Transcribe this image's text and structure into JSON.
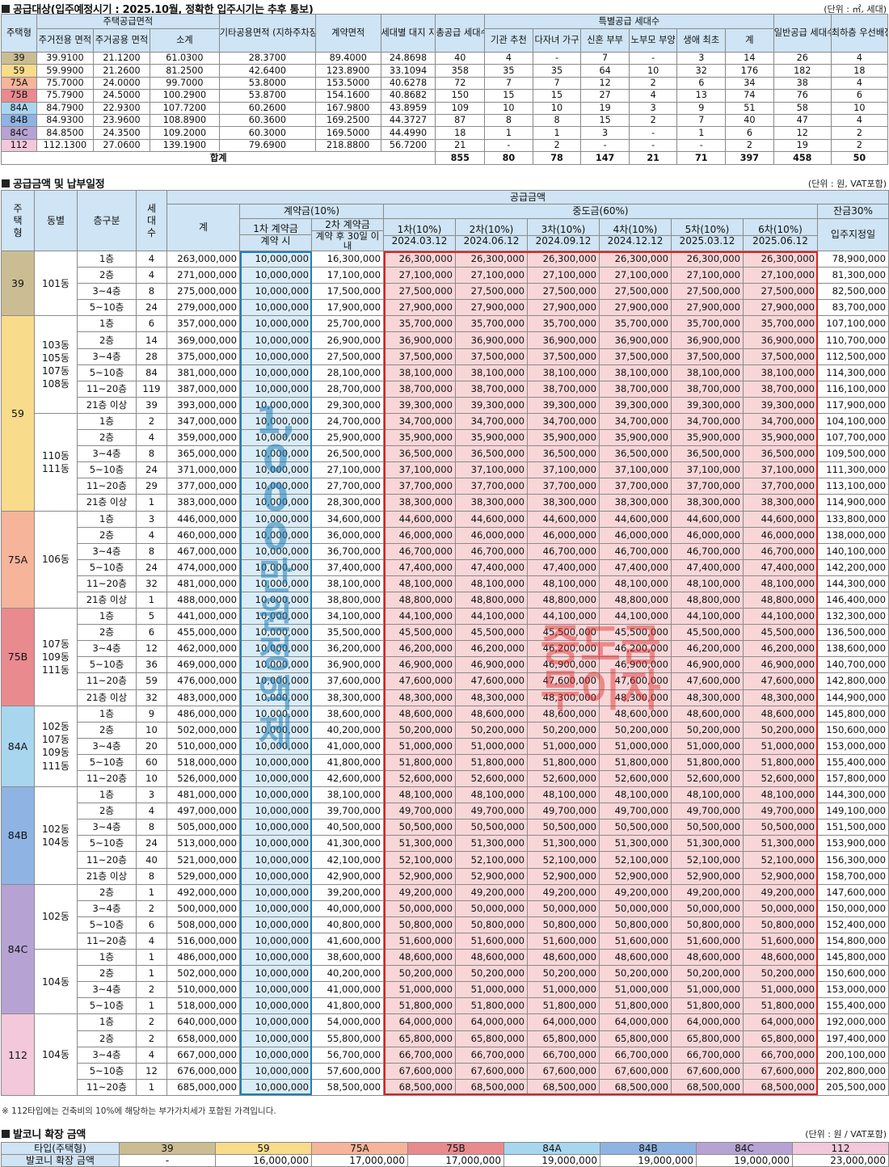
{
  "colors": {
    "t39": "#cbbd93",
    "t59": "#f8dc8c",
    "t75A": "#f6b49a",
    "t75B": "#e98a8f",
    "t84A": "#a9d6ef",
    "t84B": "#8fb3e3",
    "t84C": "#b6a3d4",
    "t112": "#f2c8da",
    "deposit_box": "#1f7fb8",
    "mid_box": "#e02020",
    "header_bg": "#cfe4f4"
  },
  "supply": {
    "title": "공급대상(입주예정시기 : 2025.10월, 정확한 입주시기는 추후 통보)",
    "unit": "(단위 : ㎡, 세대)",
    "headers": {
      "type": "주택형",
      "area_group": "주택공급면적",
      "excl": "주거전용 면적",
      "common": "주거공용 면적",
      "subtotal": "소계",
      "other": "기타공용면적 (지하주차장 등)",
      "contract": "계약면적",
      "land": "세대별 대지 지분",
      "total_units": "총공급 세대수",
      "special_group": "특별공급 세대수",
      "s1": "기관 추천",
      "s2": "다자녀 가구",
      "s3": "신혼 부부",
      "s4": "노부모 부양",
      "s5": "생애 최초",
      "s6": "계",
      "general": "일반공급 세대수",
      "lowest": "최하층 우선배정 세대수"
    },
    "rows": [
      [
        "39",
        "39.9100",
        "21.1200",
        "61.0300",
        "28.3700",
        "89.4000",
        "24.8698",
        "40",
        "4",
        "-",
        "7",
        "-",
        "3",
        "14",
        "26",
        "4"
      ],
      [
        "59",
        "59.9900",
        "21.2600",
        "81.2500",
        "42.6400",
        "123.8900",
        "33.1094",
        "358",
        "35",
        "35",
        "64",
        "10",
        "32",
        "176",
        "182",
        "18"
      ],
      [
        "75A",
        "75.7000",
        "24.0000",
        "99.7000",
        "53.8000",
        "153.5000",
        "40.6278",
        "72",
        "7",
        "7",
        "12",
        "2",
        "6",
        "34",
        "38",
        "4"
      ],
      [
        "75B",
        "75.7900",
        "24.5000",
        "100.2900",
        "53.8700",
        "154.1600",
        "40.8682",
        "150",
        "15",
        "15",
        "27",
        "4",
        "13",
        "74",
        "76",
        "6"
      ],
      [
        "84A",
        "84.7900",
        "22.9300",
        "107.7200",
        "60.2600",
        "167.9800",
        "43.8959",
        "109",
        "10",
        "10",
        "19",
        "3",
        "9",
        "51",
        "58",
        "10"
      ],
      [
        "84B",
        "84.9300",
        "23.9600",
        "108.8900",
        "60.3600",
        "169.2500",
        "44.3727",
        "87",
        "8",
        "8",
        "15",
        "2",
        "7",
        "40",
        "47",
        "4"
      ],
      [
        "84C",
        "84.8500",
        "24.3500",
        "109.2000",
        "60.3000",
        "169.5000",
        "44.4990",
        "18",
        "1",
        "1",
        "3",
        "-",
        "1",
        "6",
        "12",
        "2"
      ],
      [
        "112",
        "112.1300",
        "27.0600",
        "139.1900",
        "79.6900",
        "218.8800",
        "56.7200",
        "21",
        "-",
        "2",
        "-",
        "-",
        "-",
        "2",
        "19",
        "2"
      ]
    ],
    "total": [
      "합계",
      "855",
      "80",
      "78",
      "147",
      "21",
      "71",
      "397",
      "458",
      "50"
    ]
  },
  "payment": {
    "title": "공급금액 및 납부일정",
    "unit": "(단위 : 원, VAT포함)",
    "headers": {
      "type": "주택형",
      "dong": "동별",
      "floor": "층구분",
      "units": "세대수",
      "supply_amount": "공급금액",
      "total": "계",
      "deposit": "계약금(10%)",
      "dep1": "1차 계약금",
      "dep2": "2차 계약금",
      "dep1_when": "계약 시",
      "dep2_when": "계약 후 30일 이내",
      "middle": "중도금(60%)",
      "m1": "1차(10%)",
      "m2": "2차(10%)",
      "m3": "3차(10%)",
      "m4": "4차(10%)",
      "m5": "5차(10%)",
      "m6": "6차(10%)",
      "d1": "2024.03.12",
      "d2": "2024.06.12",
      "d3": "2024.09.12",
      "d4": "2024.12.12",
      "d5": "2025.03.12",
      "d6": "2025.06.12",
      "balance": "잔금30%",
      "balance_when": "입주지정일"
    },
    "groups": [
      {
        "type": "39",
        "color": "t39",
        "blocks": [
          {
            "dong": "101동",
            "rows": [
              [
                "1층",
                "4",
                "263,000,000",
                "10,000,000",
                "16,300,000",
                "26,300,000",
                "78,900,000"
              ],
              [
                "2층",
                "4",
                "271,000,000",
                "10,000,000",
                "17,100,000",
                "27,100,000",
                "81,300,000"
              ],
              [
                "3~4층",
                "8",
                "275,000,000",
                "10,000,000",
                "17,500,000",
                "27,500,000",
                "82,500,000"
              ],
              [
                "5~10층",
                "24",
                "279,000,000",
                "10,000,000",
                "17,900,000",
                "27,900,000",
                "83,700,000"
              ]
            ]
          }
        ]
      },
      {
        "type": "59",
        "color": "t59",
        "blocks": [
          {
            "dong": "103동 105동 107동 108동",
            "rows": [
              [
                "1층",
                "6",
                "357,000,000",
                "10,000,000",
                "25,700,000",
                "35,700,000",
                "107,100,000"
              ],
              [
                "2층",
                "14",
                "369,000,000",
                "10,000,000",
                "26,900,000",
                "36,900,000",
                "110,700,000"
              ],
              [
                "3~4층",
                "28",
                "375,000,000",
                "10,000,000",
                "27,500,000",
                "37,500,000",
                "112,500,000"
              ],
              [
                "5~10층",
                "84",
                "381,000,000",
                "10,000,000",
                "28,100,000",
                "38,100,000",
                "114,300,000"
              ],
              [
                "11~20층",
                "119",
                "387,000,000",
                "10,000,000",
                "28,700,000",
                "38,700,000",
                "116,100,000"
              ],
              [
                "21층 이상",
                "39",
                "393,000,000",
                "10,000,000",
                "29,300,000",
                "39,300,000",
                "117,900,000"
              ]
            ]
          },
          {
            "dong": "110동 111동",
            "rows": [
              [
                "1층",
                "2",
                "347,000,000",
                "10,000,000",
                "24,700,000",
                "34,700,000",
                "104,100,000"
              ],
              [
                "2층",
                "4",
                "359,000,000",
                "10,000,000",
                "25,900,000",
                "35,900,000",
                "107,700,000"
              ],
              [
                "3~4층",
                "8",
                "365,000,000",
                "10,000,000",
                "26,500,000",
                "36,500,000",
                "109,500,000"
              ],
              [
                "5~10층",
                "24",
                "371,000,000",
                "10,000,000",
                "27,100,000",
                "37,100,000",
                "111,300,000"
              ],
              [
                "11~20층",
                "29",
                "377,000,000",
                "10,000,000",
                "27,700,000",
                "37,700,000",
                "113,100,000"
              ],
              [
                "21층 이상",
                "1",
                "383,000,000",
                "10,000,000",
                "28,300,000",
                "38,300,000",
                "114,900,000"
              ]
            ]
          }
        ]
      },
      {
        "type": "75A",
        "color": "t75A",
        "blocks": [
          {
            "dong": "106동",
            "rows": [
              [
                "1층",
                "3",
                "446,000,000",
                "10,000,000",
                "34,600,000",
                "44,600,000",
                "133,800,000"
              ],
              [
                "2층",
                "4",
                "460,000,000",
                "10,000,000",
                "36,000,000",
                "46,000,000",
                "138,000,000"
              ],
              [
                "3~4층",
                "8",
                "467,000,000",
                "10,000,000",
                "36,700,000",
                "46,700,000",
                "140,100,000"
              ],
              [
                "5~10층",
                "24",
                "474,000,000",
                "10,000,000",
                "37,400,000",
                "47,400,000",
                "142,200,000"
              ],
              [
                "11~20층",
                "32",
                "481,000,000",
                "10,000,000",
                "38,100,000",
                "48,100,000",
                "144,300,000"
              ],
              [
                "21층 이상",
                "1",
                "488,000,000",
                "10,000,000",
                "38,800,000",
                "48,800,000",
                "146,400,000"
              ]
            ]
          }
        ]
      },
      {
        "type": "75B",
        "color": "t75B",
        "blocks": [
          {
            "dong": "107동 109동 111동",
            "rows": [
              [
                "1층",
                "5",
                "441,000,000",
                "10,000,000",
                "34,100,000",
                "44,100,000",
                "132,300,000"
              ],
              [
                "2층",
                "6",
                "455,000,000",
                "10,000,000",
                "35,500,000",
                "45,500,000",
                "136,500,000"
              ],
              [
                "3~4층",
                "12",
                "462,000,000",
                "10,000,000",
                "36,200,000",
                "46,200,000",
                "138,600,000"
              ],
              [
                "5~10층",
                "36",
                "469,000,000",
                "10,000,000",
                "36,900,000",
                "46,900,000",
                "140,700,000"
              ],
              [
                "11~20층",
                "59",
                "476,000,000",
                "10,000,000",
                "37,600,000",
                "47,600,000",
                "142,800,000"
              ],
              [
                "21층 이상",
                "32",
                "483,000,000",
                "10,000,000",
                "38,300,000",
                "48,300,000",
                "144,900,000"
              ]
            ]
          }
        ]
      },
      {
        "type": "84A",
        "color": "t84A",
        "blocks": [
          {
            "dong": "102동 107동 109동 111동",
            "rows": [
              [
                "1층",
                "9",
                "486,000,000",
                "10,000,000",
                "38,600,000",
                "48,600,000",
                "145,800,000"
              ],
              [
                "2층",
                "10",
                "502,000,000",
                "10,000,000",
                "40,200,000",
                "50,200,000",
                "150,600,000"
              ],
              [
                "3~4층",
                "20",
                "510,000,000",
                "10,000,000",
                "41,000,000",
                "51,000,000",
                "153,000,000"
              ],
              [
                "5~10층",
                "60",
                "518,000,000",
                "10,000,000",
                "41,800,000",
                "51,800,000",
                "155,400,000"
              ],
              [
                "11~20층",
                "10",
                "526,000,000",
                "10,000,000",
                "42,600,000",
                "52,600,000",
                "157,800,000"
              ]
            ]
          }
        ]
      },
      {
        "type": "84B",
        "color": "t84B",
        "blocks": [
          {
            "dong": "102동 104동",
            "rows": [
              [
                "1층",
                "3",
                "481,000,000",
                "10,000,000",
                "38,100,000",
                "48,100,000",
                "144,300,000"
              ],
              [
                "2층",
                "4",
                "497,000,000",
                "10,000,000",
                "39,700,000",
                "49,700,000",
                "149,100,000"
              ],
              [
                "3~4층",
                "8",
                "505,000,000",
                "10,000,000",
                "40,500,000",
                "50,500,000",
                "151,500,000"
              ],
              [
                "5~10층",
                "24",
                "513,000,000",
                "10,000,000",
                "41,300,000",
                "51,300,000",
                "153,900,000"
              ],
              [
                "11~20층",
                "40",
                "521,000,000",
                "10,000,000",
                "42,100,000",
                "52,100,000",
                "156,300,000"
              ],
              [
                "21층 이상",
                "8",
                "529,000,000",
                "10,000,000",
                "42,900,000",
                "52,900,000",
                "158,700,000"
              ]
            ]
          }
        ]
      },
      {
        "type": "84C",
        "color": "t84C",
        "blocks": [
          {
            "dong": "102동",
            "rows": [
              [
                "2층",
                "1",
                "492,000,000",
                "10,000,000",
                "39,200,000",
                "49,200,000",
                "147,600,000"
              ],
              [
                "3~4층",
                "2",
                "500,000,000",
                "10,000,000",
                "40,000,000",
                "50,000,000",
                "150,000,000"
              ],
              [
                "5~10층",
                "6",
                "508,000,000",
                "10,000,000",
                "40,800,000",
                "50,800,000",
                "152,400,000"
              ],
              [
                "11~20층",
                "4",
                "516,000,000",
                "10,000,000",
                "41,600,000",
                "51,600,000",
                "154,800,000"
              ]
            ]
          },
          {
            "dong": "104동",
            "rows": [
              [
                "1층",
                "1",
                "486,000,000",
                "10,000,000",
                "38,600,000",
                "48,600,000",
                "145,800,000"
              ],
              [
                "2층",
                "1",
                "502,000,000",
                "10,000,000",
                "40,200,000",
                "50,200,000",
                "150,600,000"
              ],
              [
                "3~4층",
                "2",
                "510,000,000",
                "10,000,000",
                "41,000,000",
                "51,000,000",
                "153,000,000"
              ],
              [
                "5~10층",
                "1",
                "518,000,000",
                "10,000,000",
                "41,800,000",
                "51,800,000",
                "155,400,000"
              ]
            ]
          }
        ]
      },
      {
        "type": "112",
        "color": "t112",
        "blocks": [
          {
            "dong": "104동",
            "rows": [
              [
                "1층",
                "2",
                "640,000,000",
                "10,000,000",
                "54,000,000",
                "64,000,000",
                "192,000,000"
              ],
              [
                "2층",
                "2",
                "658,000,000",
                "10,000,000",
                "55,800,000",
                "65,800,000",
                "197,400,000"
              ],
              [
                "3~4층",
                "4",
                "667,000,000",
                "10,000,000",
                "56,700,000",
                "66,700,000",
                "200,100,000"
              ],
              [
                "5~10층",
                "12",
                "676,000,000",
                "10,000,000",
                "57,600,000",
                "67,600,000",
                "202,800,000"
              ],
              [
                "11~20층",
                "1",
                "685,000,000",
                "10,000,000",
                "58,500,000",
                "68,500,000",
                "205,500,000"
              ]
            ]
          }
        ]
      }
    ],
    "watermark_deposit": "1,000만원 정액제",
    "watermark_middle": "중도금 무이자"
  },
  "note": "※ 112타입에는 건축비의 10%에 해당하는 부가가치세가 포함된 가격입니다.",
  "balcony": {
    "title": "발코니 확장 금액",
    "unit": "(단위 : 원 / VAT포함)",
    "type_label": "타입(주택형)",
    "amount_label": "발코니 확장 금액",
    "types": [
      "39",
      "59",
      "75A",
      "75B",
      "84A",
      "84B",
      "84C",
      "112"
    ],
    "colors": [
      "t39",
      "t59",
      "t75A",
      "t75B",
      "t84A",
      "t84B",
      "t84C",
      "t112"
    ],
    "amounts": [
      "-",
      "16,000,000",
      "17,000,000",
      "17,000,000",
      "19,000,000",
      "19,000,000",
      "19,000,000",
      "23,000,000"
    ]
  }
}
